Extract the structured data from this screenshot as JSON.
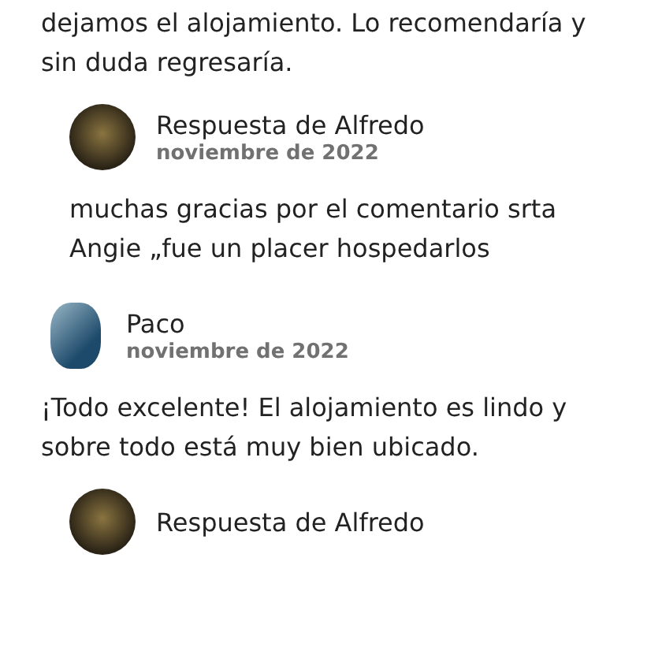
{
  "review_tail": "dejamos el alojamiento. Lo recomendaría y sin duda regresaría.",
  "entries": [
    {
      "kind": "reply",
      "author": "Respuesta de Alfredo",
      "date": "noviembre de 2022",
      "text": "muchas gracias por el comentario srta Angie „fue un placer hospedarlos"
    },
    {
      "kind": "review",
      "author": "Paco",
      "date": "noviembre de 2022",
      "text": "¡Todo excelente! El alojamiento es lindo y sobre todo está muy bien ubicado."
    },
    {
      "kind": "reply",
      "author": "Respuesta de Alfredo"
    }
  ]
}
